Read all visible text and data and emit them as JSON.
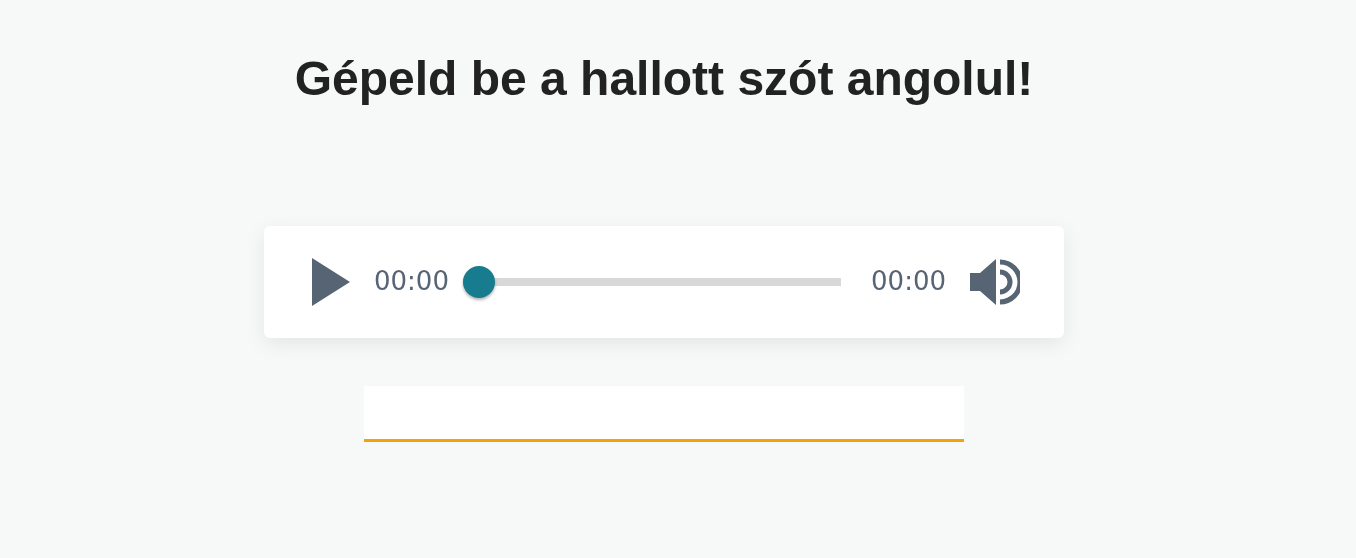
{
  "heading": "Gépeld be a hallott szót angolul!",
  "player": {
    "current_time": "00:00",
    "progress": {
      "level": 0
    },
    "duration": "00:00"
  }
}
